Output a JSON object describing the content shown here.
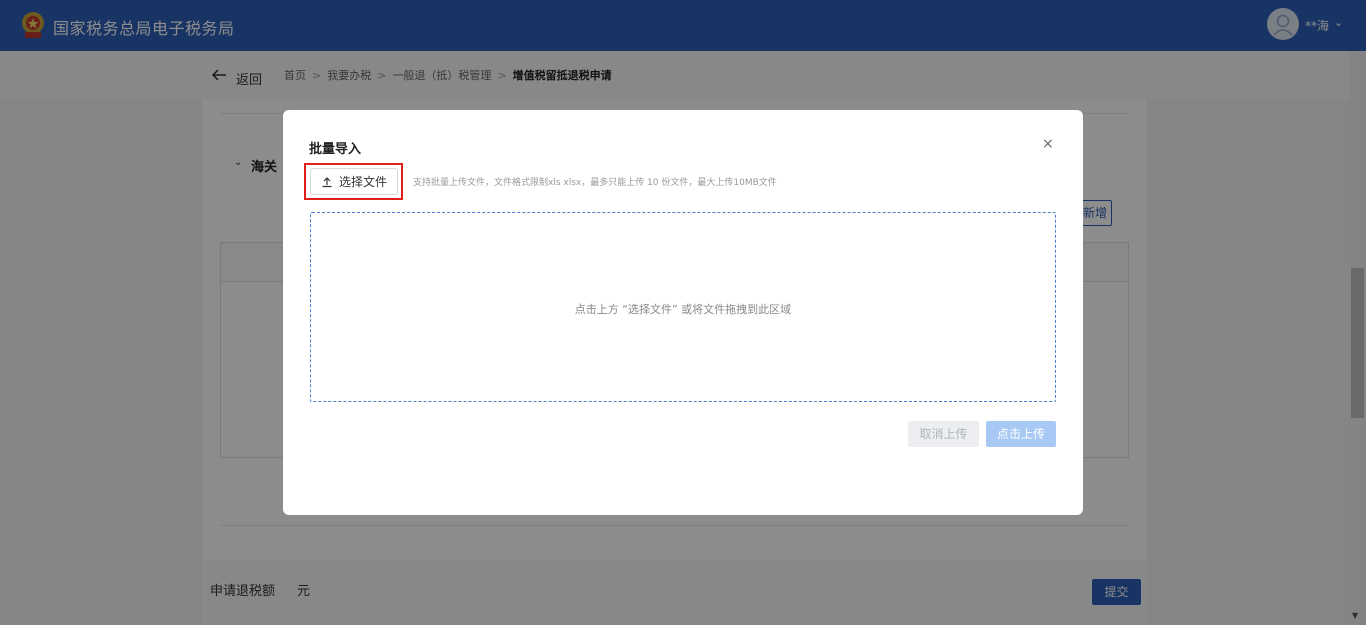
{
  "header": {
    "title": "国家税务总局电子税务局",
    "user_name": "**海",
    "user_caret": "⌄"
  },
  "breadcrumb": {
    "back_label": "返回",
    "items": [
      "首页",
      "我要办税",
      "一般退（抵）税管理",
      "增值税留抵退税申请"
    ],
    "separator": ">"
  },
  "page": {
    "section_caret": "⌄",
    "section_title": "海关",
    "add_button": "新增",
    "refund_label": "申请退税额",
    "refund_unit": "元",
    "submit_button": "提交"
  },
  "modal": {
    "title": "批量导入",
    "close_icon": "×",
    "choose_file_button": "选择文件",
    "upload_hint": "支持批量上传文件，文件格式限制xls xlsx，最多只能上传 10 份文件，最大上传10MB文件",
    "drop_zone_text": "点击上方 “选择文件” 或将文件拖拽到此区域",
    "cancel_upload_button": "取消上传",
    "confirm_upload_button": "点击上传"
  },
  "colors": {
    "header_bg": "#2c5fb8",
    "highlight_border": "#e0201c",
    "primary": "#2c5fb8",
    "disabled_primary": "#a9c9f5"
  }
}
